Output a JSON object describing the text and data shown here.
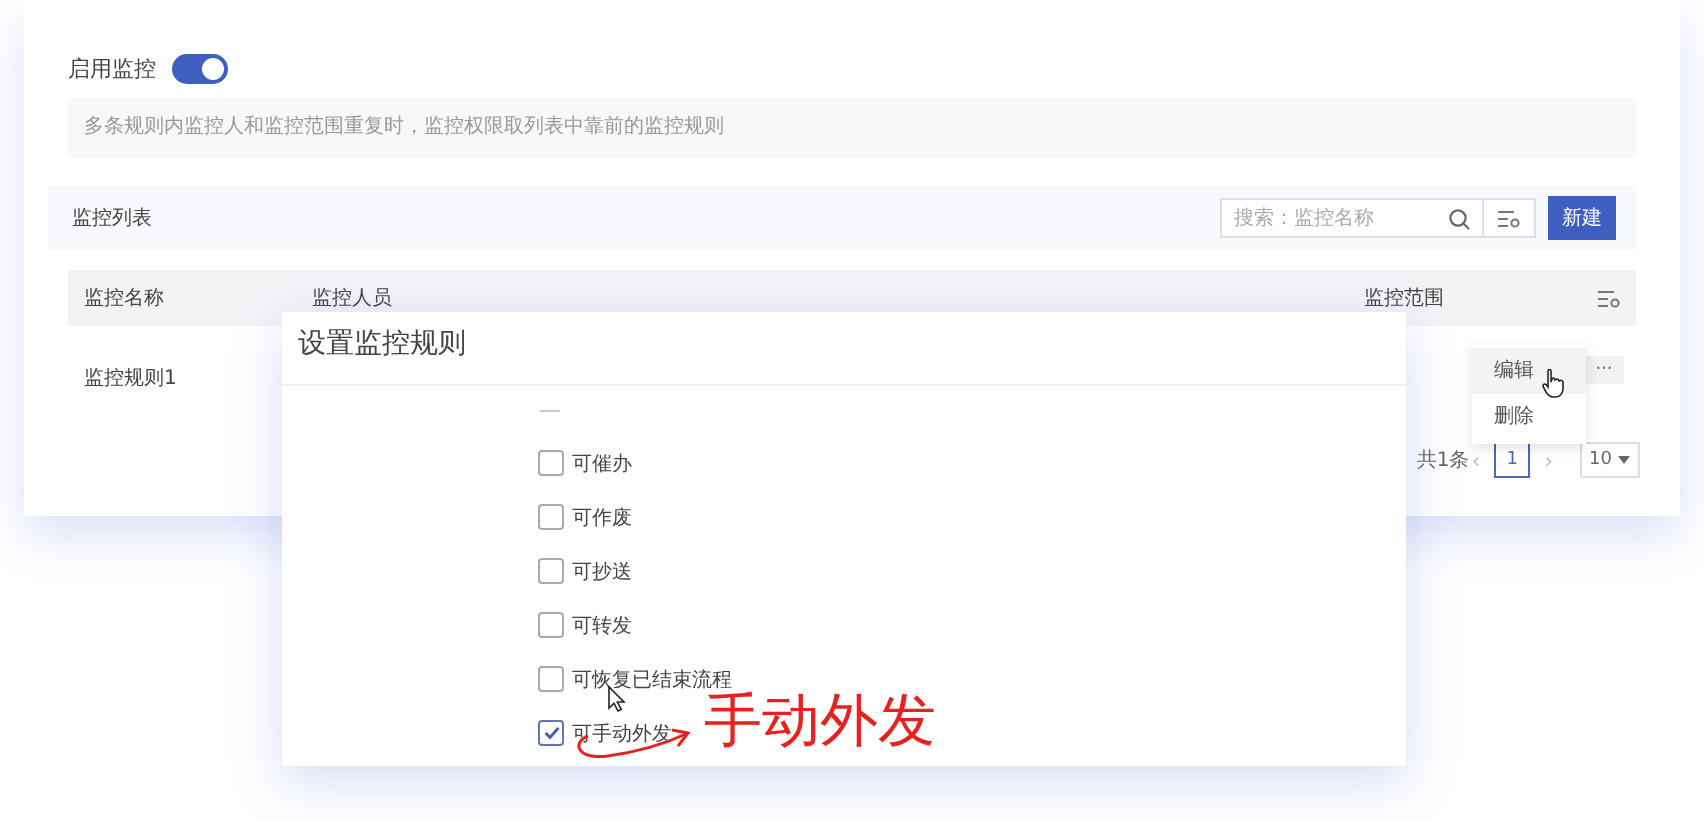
{
  "settings": {
    "label": "启用监控",
    "enabled": true,
    "note": "多条规则内监控人和监控范围重复时，监控权限取列表中靠前的监控规则"
  },
  "list": {
    "title": "监控列表",
    "search": {
      "placeholder": "搜索：监控名称"
    },
    "new_button": "新建"
  },
  "table": {
    "columns": [
      "监控名称",
      "监控人员",
      "监控范围"
    ],
    "rows": [
      {
        "name": "监控规则1",
        "more": "···"
      }
    ]
  },
  "row_menu": {
    "items": [
      {
        "label": "编辑",
        "hovered": true
      },
      {
        "label": "删除",
        "hovered": false
      }
    ]
  },
  "pagination": {
    "total": "共1条",
    "prev": "‹",
    "pages": [
      {
        "label": "1",
        "selected": true
      }
    ],
    "next": "›",
    "page_size": "10"
  },
  "dialog": {
    "title": "设置监控规则",
    "options": [
      {
        "label": "可催办",
        "checked": false
      },
      {
        "label": "可作废",
        "checked": false
      },
      {
        "label": "可抄送",
        "checked": false
      },
      {
        "label": "可转发",
        "checked": false
      },
      {
        "label": "可恢复已结束流程",
        "checked": false
      },
      {
        "label": "可手动外发",
        "checked": true
      }
    ]
  },
  "annotation": {
    "text": "手动外发"
  }
}
